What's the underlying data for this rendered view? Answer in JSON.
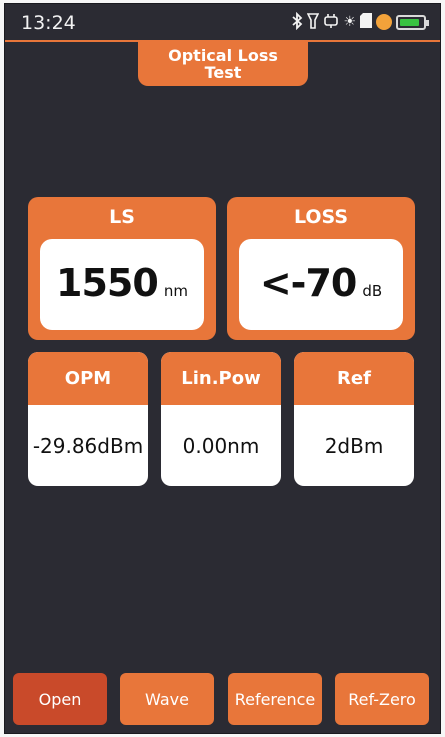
{
  "status_bar": {
    "time": "13:24",
    "icons": [
      "bluetooth-icon",
      "flashlight-icon",
      "plug-icon",
      "brightness-icon",
      "sd-card-icon",
      "charging-icon",
      "battery-icon"
    ],
    "battery_level": 0.9
  },
  "header": {
    "title_line1": "Optical Loss",
    "title_line2": "Test"
  },
  "ls": {
    "label": "LS",
    "value": "1550",
    "unit": "nm"
  },
  "loss": {
    "label": "LOSS",
    "value": "<-70",
    "unit": "dB"
  },
  "opm": {
    "label": "OPM",
    "value": "-29.86dBm"
  },
  "lin_pow": {
    "label": "Lin.Pow",
    "value": "0.00nm"
  },
  "ref": {
    "label": "Ref",
    "value": "2dBm"
  },
  "buttons": {
    "open": "Open",
    "wave": "Wave",
    "reference": "Reference",
    "ref_zero": "Ref-Zero"
  },
  "colors": {
    "accent": "#e8763a",
    "active": "#c94a2a",
    "background": "#2b2b33",
    "battery": "#39c241"
  }
}
